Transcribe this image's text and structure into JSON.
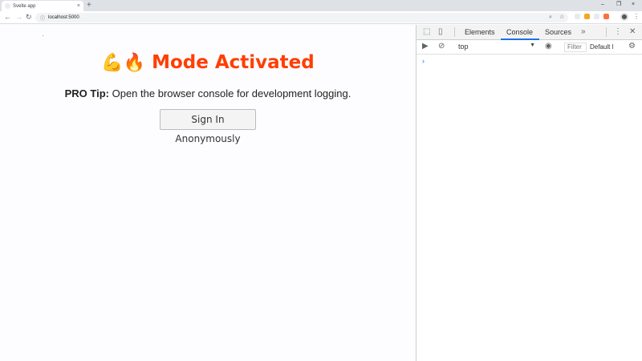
{
  "browser": {
    "tab_title": "Svelte app",
    "tab_close": "×",
    "new_tab": "+",
    "url": "localhost:5000",
    "win_minimize": "–",
    "win_restore": "❐",
    "win_close": "×"
  },
  "page": {
    "heading_emoji": "💪🔥",
    "heading_text": "Mode Activated",
    "protip_label": "PRO Tip:",
    "protip_text": " Open the browser console for development logging.",
    "signin_label": "Sign In Anonymously",
    "accent_color": "#ff3e00"
  },
  "devtools": {
    "tabs": [
      "Elements",
      "Console",
      "Sources"
    ],
    "active_tab": "Console",
    "more_tabs": "»",
    "context": "top",
    "filter_placeholder": "Filter",
    "levels": "Default l",
    "prompt": "›"
  }
}
